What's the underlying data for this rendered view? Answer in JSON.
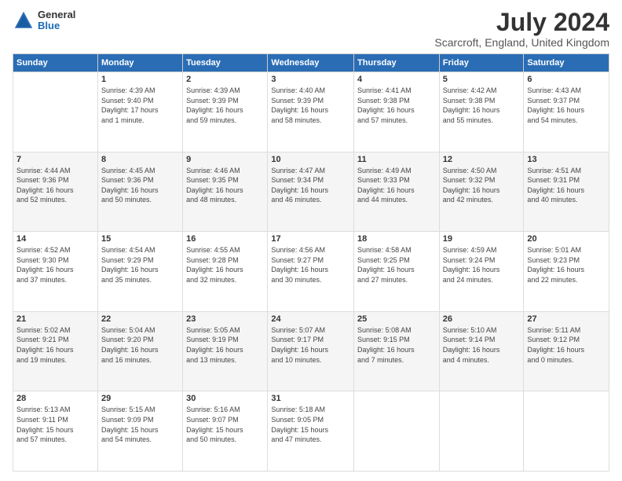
{
  "logo": {
    "general": "General",
    "blue": "Blue"
  },
  "title": {
    "month_year": "July 2024",
    "location": "Scarcroft, England, United Kingdom"
  },
  "headers": [
    "Sunday",
    "Monday",
    "Tuesday",
    "Wednesday",
    "Thursday",
    "Friday",
    "Saturday"
  ],
  "weeks": [
    [
      {
        "date": "",
        "info": ""
      },
      {
        "date": "1",
        "info": "Sunrise: 4:39 AM\nSunset: 9:40 PM\nDaylight: 17 hours\nand 1 minute."
      },
      {
        "date": "2",
        "info": "Sunrise: 4:39 AM\nSunset: 9:39 PM\nDaylight: 16 hours\nand 59 minutes."
      },
      {
        "date": "3",
        "info": "Sunrise: 4:40 AM\nSunset: 9:39 PM\nDaylight: 16 hours\nand 58 minutes."
      },
      {
        "date": "4",
        "info": "Sunrise: 4:41 AM\nSunset: 9:38 PM\nDaylight: 16 hours\nand 57 minutes."
      },
      {
        "date": "5",
        "info": "Sunrise: 4:42 AM\nSunset: 9:38 PM\nDaylight: 16 hours\nand 55 minutes."
      },
      {
        "date": "6",
        "info": "Sunrise: 4:43 AM\nSunset: 9:37 PM\nDaylight: 16 hours\nand 54 minutes."
      }
    ],
    [
      {
        "date": "7",
        "info": "Sunrise: 4:44 AM\nSunset: 9:36 PM\nDaylight: 16 hours\nand 52 minutes."
      },
      {
        "date": "8",
        "info": "Sunrise: 4:45 AM\nSunset: 9:36 PM\nDaylight: 16 hours\nand 50 minutes."
      },
      {
        "date": "9",
        "info": "Sunrise: 4:46 AM\nSunset: 9:35 PM\nDaylight: 16 hours\nand 48 minutes."
      },
      {
        "date": "10",
        "info": "Sunrise: 4:47 AM\nSunset: 9:34 PM\nDaylight: 16 hours\nand 46 minutes."
      },
      {
        "date": "11",
        "info": "Sunrise: 4:49 AM\nSunset: 9:33 PM\nDaylight: 16 hours\nand 44 minutes."
      },
      {
        "date": "12",
        "info": "Sunrise: 4:50 AM\nSunset: 9:32 PM\nDaylight: 16 hours\nand 42 minutes."
      },
      {
        "date": "13",
        "info": "Sunrise: 4:51 AM\nSunset: 9:31 PM\nDaylight: 16 hours\nand 40 minutes."
      }
    ],
    [
      {
        "date": "14",
        "info": "Sunrise: 4:52 AM\nSunset: 9:30 PM\nDaylight: 16 hours\nand 37 minutes."
      },
      {
        "date": "15",
        "info": "Sunrise: 4:54 AM\nSunset: 9:29 PM\nDaylight: 16 hours\nand 35 minutes."
      },
      {
        "date": "16",
        "info": "Sunrise: 4:55 AM\nSunset: 9:28 PM\nDaylight: 16 hours\nand 32 minutes."
      },
      {
        "date": "17",
        "info": "Sunrise: 4:56 AM\nSunset: 9:27 PM\nDaylight: 16 hours\nand 30 minutes."
      },
      {
        "date": "18",
        "info": "Sunrise: 4:58 AM\nSunset: 9:25 PM\nDaylight: 16 hours\nand 27 minutes."
      },
      {
        "date": "19",
        "info": "Sunrise: 4:59 AM\nSunset: 9:24 PM\nDaylight: 16 hours\nand 24 minutes."
      },
      {
        "date": "20",
        "info": "Sunrise: 5:01 AM\nSunset: 9:23 PM\nDaylight: 16 hours\nand 22 minutes."
      }
    ],
    [
      {
        "date": "21",
        "info": "Sunrise: 5:02 AM\nSunset: 9:21 PM\nDaylight: 16 hours\nand 19 minutes."
      },
      {
        "date": "22",
        "info": "Sunrise: 5:04 AM\nSunset: 9:20 PM\nDaylight: 16 hours\nand 16 minutes."
      },
      {
        "date": "23",
        "info": "Sunrise: 5:05 AM\nSunset: 9:19 PM\nDaylight: 16 hours\nand 13 minutes."
      },
      {
        "date": "24",
        "info": "Sunrise: 5:07 AM\nSunset: 9:17 PM\nDaylight: 16 hours\nand 10 minutes."
      },
      {
        "date": "25",
        "info": "Sunrise: 5:08 AM\nSunset: 9:15 PM\nDaylight: 16 hours\nand 7 minutes."
      },
      {
        "date": "26",
        "info": "Sunrise: 5:10 AM\nSunset: 9:14 PM\nDaylight: 16 hours\nand 4 minutes."
      },
      {
        "date": "27",
        "info": "Sunrise: 5:11 AM\nSunset: 9:12 PM\nDaylight: 16 hours\nand 0 minutes."
      }
    ],
    [
      {
        "date": "28",
        "info": "Sunrise: 5:13 AM\nSunset: 9:11 PM\nDaylight: 15 hours\nand 57 minutes."
      },
      {
        "date": "29",
        "info": "Sunrise: 5:15 AM\nSunset: 9:09 PM\nDaylight: 15 hours\nand 54 minutes."
      },
      {
        "date": "30",
        "info": "Sunrise: 5:16 AM\nSunset: 9:07 PM\nDaylight: 15 hours\nand 50 minutes."
      },
      {
        "date": "31",
        "info": "Sunrise: 5:18 AM\nSunset: 9:05 PM\nDaylight: 15 hours\nand 47 minutes."
      },
      {
        "date": "",
        "info": ""
      },
      {
        "date": "",
        "info": ""
      },
      {
        "date": "",
        "info": ""
      }
    ]
  ]
}
